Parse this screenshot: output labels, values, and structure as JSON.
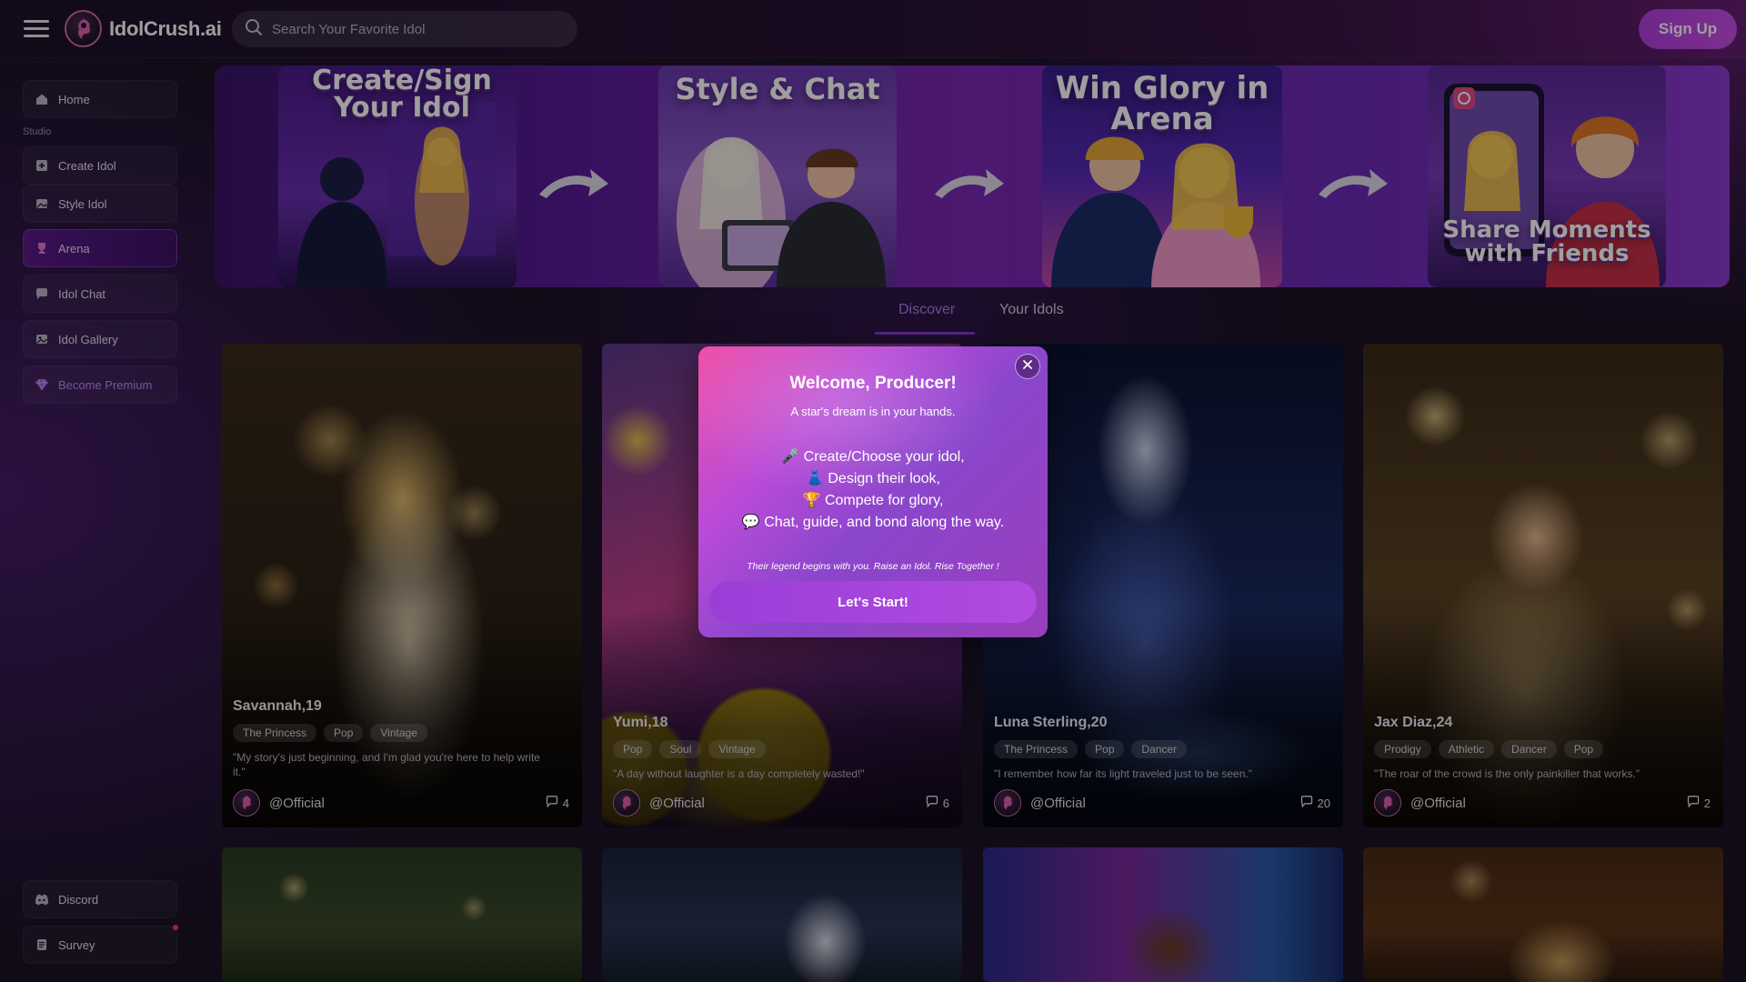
{
  "header": {
    "brand": "IdolCrush.ai",
    "search_placeholder": "Search Your Favorite Idol",
    "signup_label": "Sign Up"
  },
  "sidebar": {
    "section_studio": "Studio",
    "items": [
      {
        "label": "Home",
        "icon": "home-icon"
      },
      {
        "label": "Create Idol",
        "icon": "plus-square-icon"
      },
      {
        "label": "Style Idol",
        "icon": "image-edit-icon"
      },
      {
        "label": "Arena",
        "icon": "trophy-icon",
        "active": true
      },
      {
        "label": "Idol Chat",
        "icon": "chat-bubble-icon"
      },
      {
        "label": "Idol Gallery",
        "icon": "gallery-icon"
      },
      {
        "label": "Become Premium",
        "icon": "diamond-icon"
      }
    ],
    "bottom_items": [
      {
        "label": "Discord",
        "icon": "discord-icon"
      },
      {
        "label": "Survey",
        "icon": "survey-icon",
        "has_notification": true
      }
    ]
  },
  "banner": {
    "panels": [
      {
        "title_line1": "Create/Sign",
        "title_line2": "Your Idol"
      },
      {
        "title_line1": "Style & Chat",
        "title_line2": ""
      },
      {
        "title_line1": "Win Glory in",
        "title_line2": "Arena"
      },
      {
        "title_line1": "Share Moments",
        "title_line2": "with Friends"
      }
    ]
  },
  "tabs": [
    {
      "label": "Discover",
      "active": true
    },
    {
      "label": "Your Idols",
      "active": false
    }
  ],
  "cards": [
    {
      "name": "Savannah,19",
      "tags": [
        "The Princess",
        "Pop",
        "Vintage"
      ],
      "quote": "\"My story's just beginning, and I'm glad you're here to help write it.\"",
      "author": "@Official",
      "comments": "4"
    },
    {
      "name": "Yumi,18",
      "tags": [
        "Pop",
        "Soul",
        "Vintage"
      ],
      "quote": "\"A day without laughter is a day completely wasted!\"",
      "author": "@Official",
      "comments": "6"
    },
    {
      "name": "Luna Sterling,20",
      "tags": [
        "The Princess",
        "Pop",
        "Dancer"
      ],
      "quote": "\"I remember how far its light traveled just to be seen.\"",
      "author": "@Official",
      "comments": "20"
    },
    {
      "name": "Jax Diaz,24",
      "tags": [
        "Prodigy",
        "Athletic",
        "Dancer",
        "Pop"
      ],
      "quote": "\"The roar of the crowd is the only painkiller that works.\"",
      "author": "@Official",
      "comments": "2"
    }
  ],
  "modal": {
    "title": "Welcome, Producer!",
    "subtitle": "A star's dream is in your hands.",
    "lines": [
      "🎤 Create/Choose your idol,",
      "👗 Design their look,",
      "🏆 Compete for glory,",
      "💬 Chat, guide, and bond along the way."
    ],
    "footer": "Their legend begins with you. Raise an Idol. Rise Together !",
    "button_label": "Let's Start!"
  },
  "colors": {
    "accent": "#b23fe0",
    "tab_active": "#b67ae8",
    "background": "#1c1228"
  }
}
